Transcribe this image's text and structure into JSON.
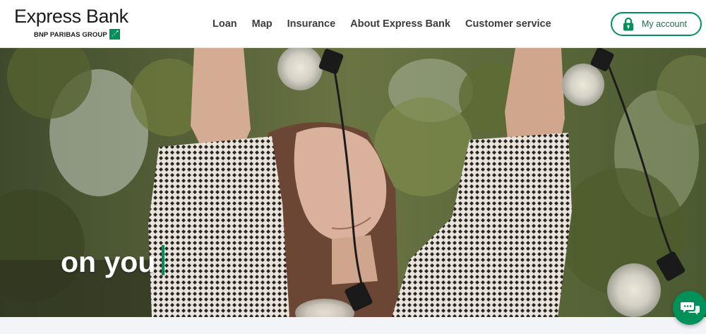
{
  "header": {
    "brand_name": "Express Bank",
    "brand_group": "BNP PARIBAS GROUP",
    "nav": [
      "Loan",
      "Map",
      "Insurance",
      "About Express Bank",
      "Customer service"
    ],
    "account_label": "My account"
  },
  "hero": {
    "headline": "on you"
  },
  "colors": {
    "accent": "#00915a",
    "nav_text": "#3d3d3d",
    "brand_text": "#1b1b1b",
    "hero_text": "#ffffff",
    "bottom_strip": "#f2f4f8"
  },
  "icons": {
    "brand_mark": "bnp-stars-logo-icon",
    "account": "padlock-icon",
    "chat": "chat-bubbles-icon"
  }
}
